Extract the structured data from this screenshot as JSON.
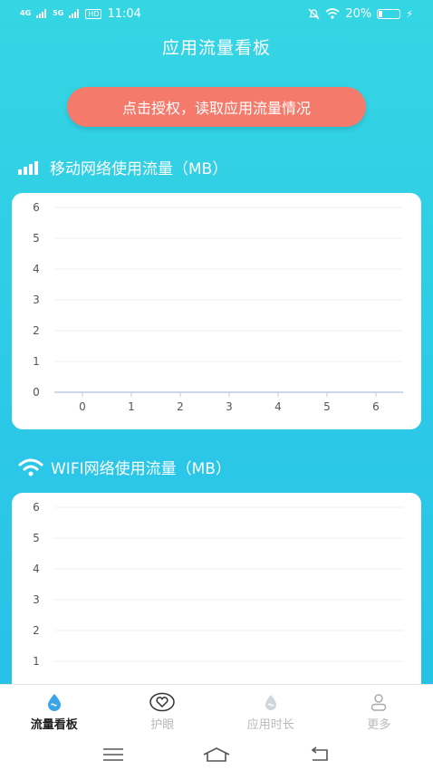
{
  "status_bar": {
    "signal_1": "4G",
    "signal_2": "5G",
    "hd": "HD",
    "time": "11:04",
    "battery": "20%",
    "battery_level": 0.2
  },
  "header": {
    "title": "应用流量看板"
  },
  "auth_button": {
    "label": "点击授权，读取应用流量情况"
  },
  "mobile_section": {
    "title": "移动网络使用流量（MB）"
  },
  "wifi_section": {
    "title": "WIFI网络使用流量（MB）"
  },
  "chart_data": [
    {
      "type": "line",
      "x_ticks": [
        "0",
        "1",
        "2",
        "3",
        "4",
        "5",
        "6"
      ],
      "y_ticks": [
        "0",
        "1",
        "2",
        "3",
        "4",
        "5",
        "6"
      ],
      "xlim": [
        0,
        6
      ],
      "ylim": [
        0,
        6
      ],
      "series": [],
      "grid": true
    },
    {
      "type": "line",
      "y_ticks": [
        "1",
        "2",
        "3",
        "4",
        "5",
        "6"
      ],
      "ylim": [
        0,
        6
      ],
      "series": [],
      "grid": true
    }
  ],
  "tabs": [
    {
      "label": "流量看板",
      "icon": "water-drop-icon",
      "active": true
    },
    {
      "label": "护眼",
      "icon": "eye-heart-icon",
      "active": false
    },
    {
      "label": "应用时长",
      "icon": "drop-icon",
      "active": false
    },
    {
      "label": "更多",
      "icon": "user-icon",
      "active": false
    }
  ]
}
